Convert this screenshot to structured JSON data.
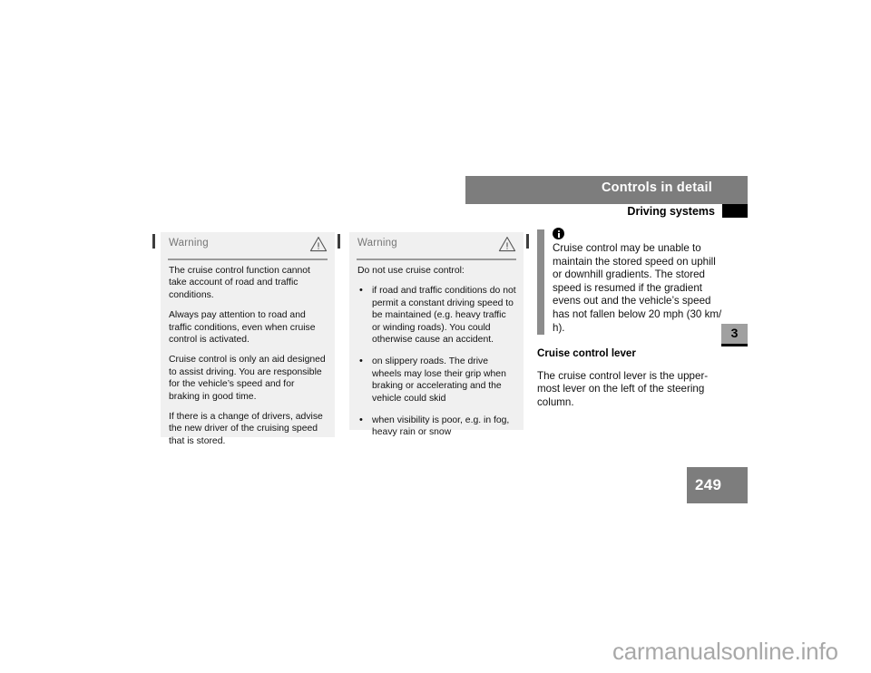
{
  "header": {
    "title": "Controls in detail",
    "subtitle": "Driving systems"
  },
  "chapter_tab": {
    "number": "3"
  },
  "page_badge": {
    "number": "249"
  },
  "warning_box_1": {
    "label": "Warning",
    "icon": "warning-triangle-icon",
    "paragraphs": [
      "The cruise control function cannot take account of road and traffic conditions.",
      "Always pay attention to road and traffic conditions, even when cruise control is activated.",
      "Cruise control is only an aid designed to assist driving. You are responsible for the vehicle’s speed and for braking in good time.",
      "If there is a change of drivers, advise the new driver of the cruising speed that is stored."
    ]
  },
  "warning_box_2": {
    "label": "Warning",
    "icon": "warning-triangle-icon",
    "intro": "Do not use cruise control:",
    "bullet_char": "•",
    "items": [
      "if road and traffic conditions do not permit a constant driving speed to be maintained (e.g. heavy traffic or winding roads). You could otherwise cause an accident.",
      "on slippery roads. The drive wheels may lose their grip when braking or accelerating and the vehicle could skid",
      "when visibility is poor, e.g. in fog, heavy rain or snow"
    ]
  },
  "note": {
    "icon": "info-circle-icon",
    "text": "Cruise control may be unable to maintain the stored speed on uphill or downhill gradients. The stored speed is resumed if the gradient evens out and the vehicle’s speed has not fallen below 20 mph (30 km/ h)."
  },
  "section": {
    "heading": "Cruise control lever",
    "body": "The cruise control lever is the upper-most lever on the left of the steering column."
  },
  "watermark": {
    "text": "carmanualsonline.info"
  },
  "colors": {
    "header_gray": "#7d7d7d",
    "box_gray": "#f0f0f0",
    "note_bar_gray": "#8c8c8c",
    "tab_gray": "#a0a0a0",
    "watermark_gray": "#a8a8a8"
  }
}
